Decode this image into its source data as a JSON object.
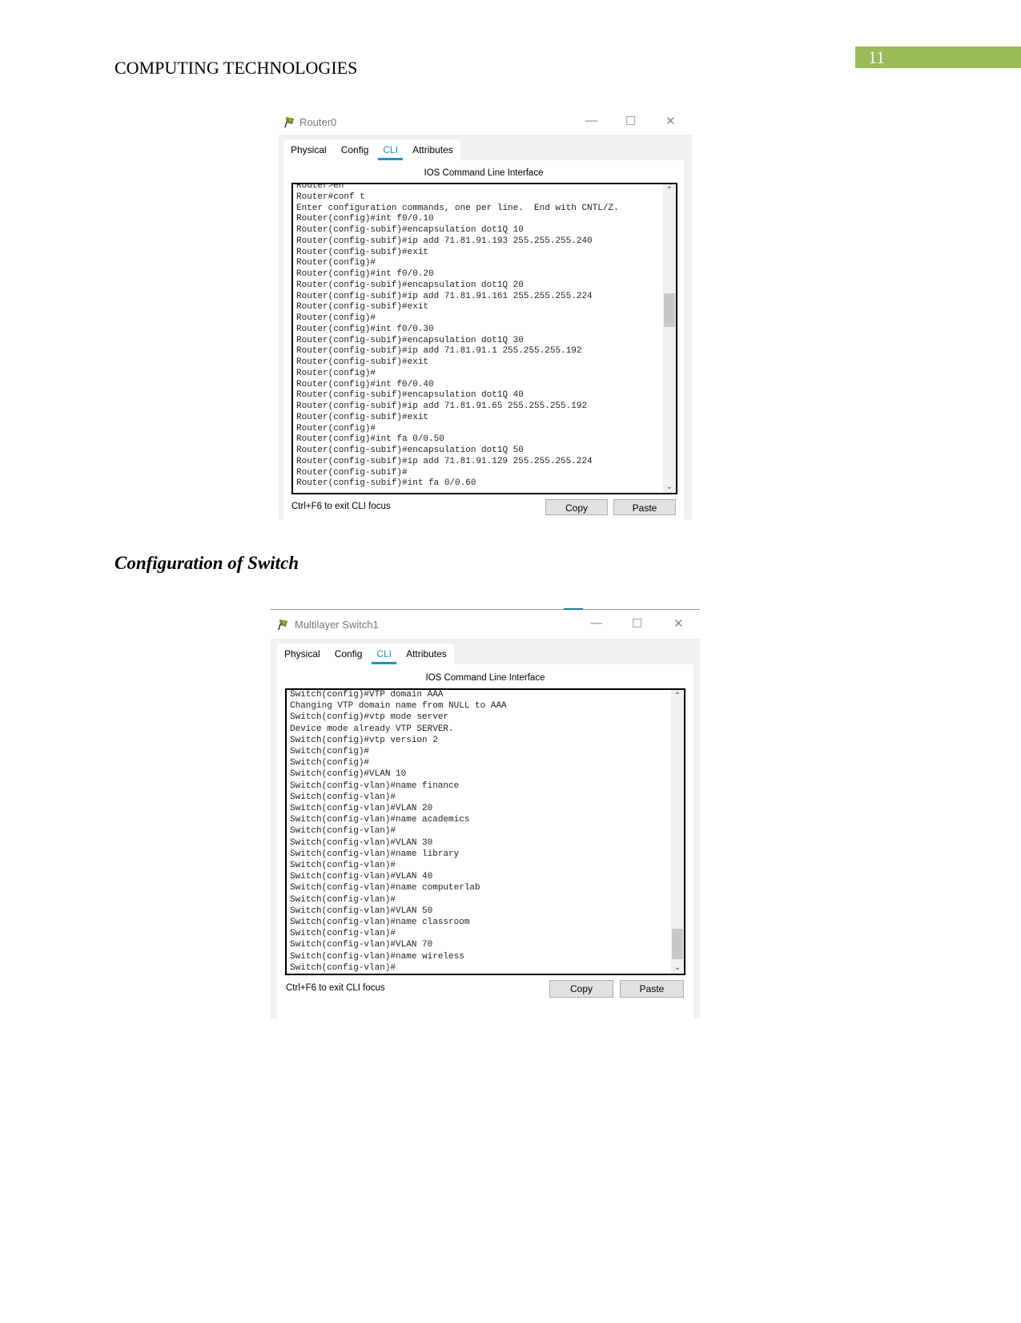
{
  "header": {
    "title": "COMPUTING TECHNOLOGIES",
    "page_number": "11",
    "accent": "#9bbb59"
  },
  "router_window": {
    "title": "Router0",
    "tabs": [
      "Physical",
      "Config",
      "CLI",
      "Attributes"
    ],
    "active_tab": "CLI",
    "caption": "IOS Command Line Interface",
    "lines": [
      "Router>en",
      "Router#conf t",
      "Enter configuration commands, one per line.  End with CNTL/Z.",
      "Router(config)#int f0/0.10",
      "Router(config-subif)#encapsulation dot1Q 10",
      "Router(config-subif)#ip add 71.81.91.193 255.255.255.240",
      "Router(config-subif)#exit",
      "Router(config)#",
      "Router(config)#int f0/0.20",
      "Router(config-subif)#encapsulation dot1Q 20",
      "Router(config-subif)#ip add 71.81.91.161 255.255.255.224",
      "Router(config-subif)#exit",
      "Router(config)#",
      "Router(config)#int f0/0.30",
      "Router(config-subif)#encapsulation dot1Q 30",
      "Router(config-subif)#ip add 71.81.91.1 255.255.255.192",
      "Router(config-subif)#exit",
      "Router(config)#",
      "Router(config)#int f0/0.40",
      "Router(config-subif)#encapsulation dot1Q 40",
      "Router(config-subif)#ip add 71.81.91.65 255.255.255.192",
      "Router(config-subif)#exit",
      "Router(config)#",
      "Router(config)#int fa 0/0.50",
      "Router(config-subif)#encapsulation dot1Q 50",
      "Router(config-subif)#ip add 71.81.91.129 255.255.255.224",
      "Router(config-subif)#",
      "Router(config-subif)#int fa 0/0.60"
    ],
    "footer_hint": "Ctrl+F6 to exit CLI focus",
    "copy_label": "Copy",
    "paste_label": "Paste"
  },
  "section_heading": "Configuration of Switch",
  "switch_window": {
    "title": "Multilayer Switch1",
    "tabs": [
      "Physical",
      "Config",
      "CLI",
      "Attributes"
    ],
    "active_tab": "CLI",
    "caption": "IOS Command Line Interface",
    "lines": [
      "Switch(config)#VTP domain AAA",
      "Changing VTP domain name from NULL to AAA",
      "Switch(config)#vtp mode server",
      "Device mode already VTP SERVER.",
      "Switch(config)#vtp version 2",
      "Switch(config)#",
      "Switch(config)#",
      "Switch(config)#VLAN 10",
      "Switch(config-vlan)#name finance",
      "Switch(config-vlan)#",
      "Switch(config-vlan)#VLAN 20",
      "Switch(config-vlan)#name academics",
      "Switch(config-vlan)#",
      "Switch(config-vlan)#VLAN 30",
      "Switch(config-vlan)#name library",
      "Switch(config-vlan)#",
      "Switch(config-vlan)#VLAN 40",
      "Switch(config-vlan)#name computerlab",
      "Switch(config-vlan)#",
      "Switch(config-vlan)#VLAN 50",
      "Switch(config-vlan)#name classroom",
      "Switch(config-vlan)#",
      "Switch(config-vlan)#VLAN 70",
      "Switch(config-vlan)#name wireless",
      "Switch(config-vlan)#"
    ],
    "footer_hint": "Ctrl+F6 to exit CLI focus",
    "copy_label": "Copy",
    "paste_label": "Paste"
  }
}
